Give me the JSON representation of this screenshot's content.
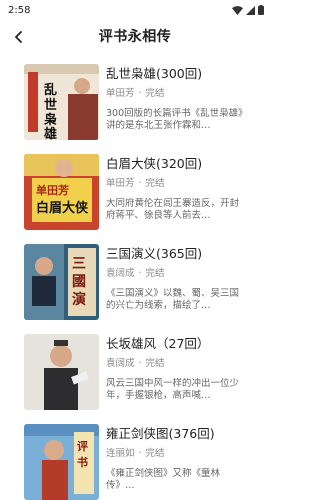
{
  "status": {
    "time": "2:58"
  },
  "header": {
    "title": "评书永相传"
  },
  "items": [
    {
      "title": "乱世枭雄(300回)",
      "author": "单田芳",
      "status": "完结",
      "desc": "300回版的长篇评书《乱世枭雄》讲的是东北王张作霖和…",
      "cover_text": "乱世枭雄"
    },
    {
      "title": "白眉大侠(320回)",
      "author": "单田芳",
      "status": "完结",
      "desc": "大同府黄伦在闾王寨造反，开封府蒋平、徐良等人前去…",
      "cover_text": "单田芳白眉大侠"
    },
    {
      "title": "三国演义(365回)",
      "author": "袁阔成",
      "status": "完结",
      "desc": "《三国演义》以魏、蜀、吴三国的兴亡为线索，描绘了…",
      "cover_text": "三國演義"
    },
    {
      "title": "长坂雄风（27回）",
      "author": "袁阔成",
      "status": "完结",
      "desc": "风云三国中风一样的冲出一位少年，手握银枪，高声喊…",
      "cover_text": ""
    },
    {
      "title": "雍正剑侠图(376回)",
      "author": "连丽如",
      "status": "完结",
      "desc": "《雍正剑侠图》又称《童林传》…",
      "cover_text": "评书"
    }
  ]
}
